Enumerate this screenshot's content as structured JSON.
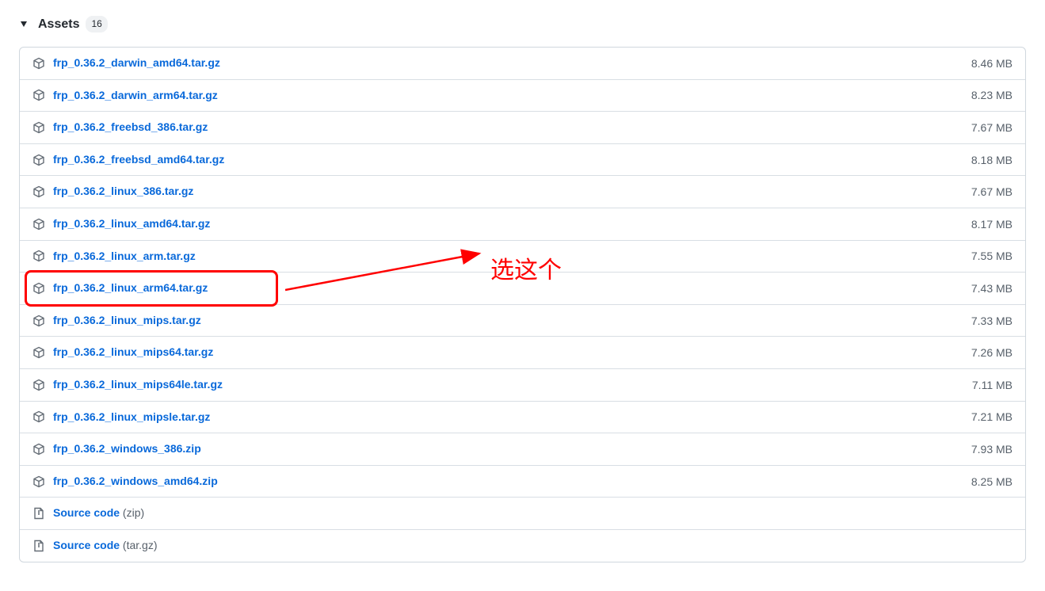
{
  "header": {
    "title": "Assets",
    "count": "16"
  },
  "annotation": {
    "text": "选这个"
  },
  "assets": [
    {
      "name": "frp_0.36.2_darwin_amd64.tar.gz",
      "size": "8.46 MB",
      "icon": "package"
    },
    {
      "name": "frp_0.36.2_darwin_arm64.tar.gz",
      "size": "8.23 MB",
      "icon": "package"
    },
    {
      "name": "frp_0.36.2_freebsd_386.tar.gz",
      "size": "7.67 MB",
      "icon": "package"
    },
    {
      "name": "frp_0.36.2_freebsd_amd64.tar.gz",
      "size": "8.18 MB",
      "icon": "package"
    },
    {
      "name": "frp_0.36.2_linux_386.tar.gz",
      "size": "7.67 MB",
      "icon": "package"
    },
    {
      "name": "frp_0.36.2_linux_amd64.tar.gz",
      "size": "8.17 MB",
      "icon": "package"
    },
    {
      "name": "frp_0.36.2_linux_arm.tar.gz",
      "size": "7.55 MB",
      "icon": "package"
    },
    {
      "name": "frp_0.36.2_linux_arm64.tar.gz",
      "size": "7.43 MB",
      "icon": "package",
      "highlighted": true
    },
    {
      "name": "frp_0.36.2_linux_mips.tar.gz",
      "size": "7.33 MB",
      "icon": "package"
    },
    {
      "name": "frp_0.36.2_linux_mips64.tar.gz",
      "size": "7.26 MB",
      "icon": "package"
    },
    {
      "name": "frp_0.36.2_linux_mips64le.tar.gz",
      "size": "7.11 MB",
      "icon": "package"
    },
    {
      "name": "frp_0.36.2_linux_mipsle.tar.gz",
      "size": "7.21 MB",
      "icon": "package"
    },
    {
      "name": "frp_0.36.2_windows_386.zip",
      "size": "7.93 MB",
      "icon": "package"
    },
    {
      "name": "frp_0.36.2_windows_amd64.zip",
      "size": "8.25 MB",
      "icon": "package"
    },
    {
      "name": "Source code",
      "ext": "(zip)",
      "size": "",
      "icon": "zip"
    },
    {
      "name": "Source code",
      "ext": "(tar.gz)",
      "size": "",
      "icon": "zip"
    }
  ]
}
